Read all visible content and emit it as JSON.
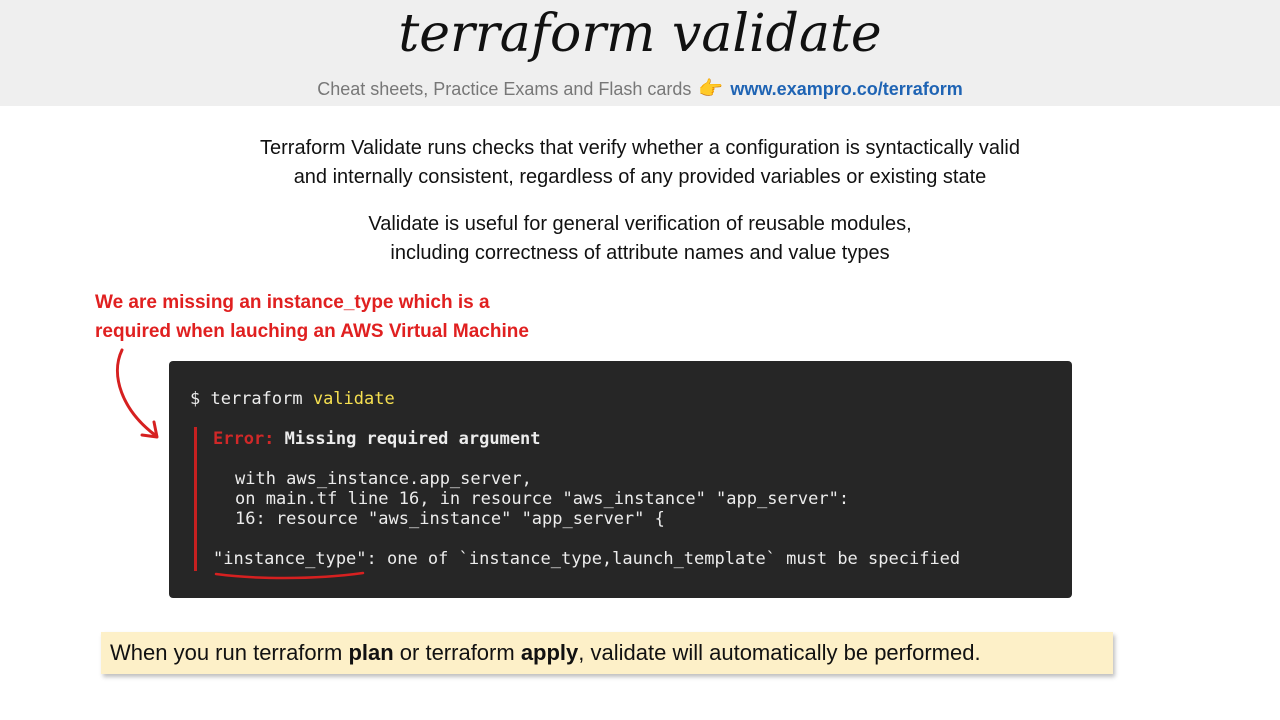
{
  "header": {
    "title": "terraform validate",
    "subtitle_text": "Cheat sheets, Practice Exams and Flash cards",
    "subtitle_icon": "pointing-hand-icon",
    "link": "www.exampro.co/terraform"
  },
  "paragraphs": {
    "p1_line1": "Terraform Validate runs checks that verify whether a configuration is syntactically valid",
    "p1_line2": "and internally consistent, regardless of any provided variables or existing state",
    "p2_line1": "Validate is useful for general verification of reusable modules,",
    "p2_line2": "including correctness of attribute names and value types"
  },
  "annotation": {
    "line1": "We are missing an instance_type which is a",
    "line2": "required when lauching an AWS Virtual Machine",
    "color": "#e02020"
  },
  "terminal": {
    "prompt": "$ terraform ",
    "command_keyword": "validate",
    "error_label": "Error:",
    "error_title": " Missing required argument",
    "context_line1": "with aws_instance.app_server,",
    "context_line2": "on main.tf line 16, in resource \"aws_instance\" \"app_server\":",
    "context_line3": "16: resource \"aws_instance\" \"app_server\" {",
    "message": "\"instance_type\": one of `instance_type,launch_template` must be specified"
  },
  "note": {
    "part1": "When you run terraform ",
    "bold1": "plan",
    "part2": " or terraform ",
    "bold2": "apply",
    "part3": ", validate will automatically be performed."
  }
}
